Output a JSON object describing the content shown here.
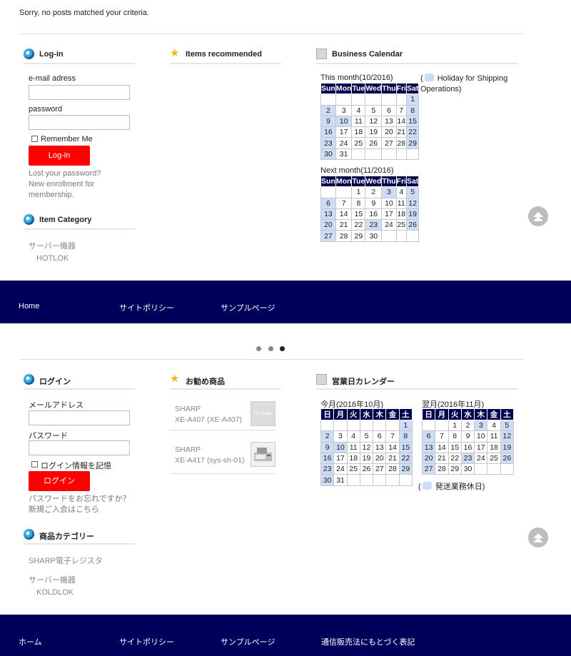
{
  "notice": "Sorry, no posts matched your criteria.",
  "en": {
    "login": {
      "title": "Log-in",
      "email_label": "e-mail adress",
      "email_value": "",
      "password_label": "password",
      "password_value": "",
      "remember": "Remember Me",
      "button": "Log-in",
      "lost": "Lost your password?",
      "new1": "New enrollment for",
      "new2": "membership."
    },
    "category": {
      "title": "Item Category",
      "items": [
        "サーバー機器",
        "HOTLOK"
      ]
    },
    "recommended": {
      "title": "Items recommended"
    },
    "calendar": {
      "title": "Business Calendar",
      "this_month": "This month(10/2016)",
      "next_month": "Next month(11/2016)",
      "legend_open": "(",
      "legend": "Holiday for Shipping",
      "legend2": "Operations)",
      "weekdays": [
        "Sun",
        "Mon",
        "Tue",
        "Wed",
        "Thu",
        "Fri",
        "Sat"
      ]
    },
    "footer": [
      "Home",
      "サイトポリシー",
      "サンプルページ"
    ]
  },
  "jp": {
    "login": {
      "title": "ログイン",
      "email_label": "メールアドレス",
      "email_value": "",
      "password_label": "パスワード",
      "password_value": "",
      "remember": "ログイン情報を記憶",
      "button": "ログイン",
      "lost": "パスワードをお忘れですか？",
      "new": "新規ご入会はこちら"
    },
    "category": {
      "title": "商品カテゴリー",
      "items": [
        "SHARP電子レジスタ",
        "サーバー機器",
        "KOLDLOK"
      ]
    },
    "recommended": {
      "title": "お勧め商品",
      "items": [
        {
          "brand": "SHARP",
          "name": "XE-A407 (XE-A407)",
          "thumb": "No Image"
        },
        {
          "brand": "SHARP",
          "name": "XE-A417 (sys-sh-01)",
          "thumb": ""
        }
      ]
    },
    "calendar": {
      "title": "営業日カレンダー",
      "this_month": "今月(2016年10月)",
      "next_month": "翌月(2016年11月)",
      "legend_open": "(",
      "legend": "発送業務休日)",
      "weekdays": [
        "日",
        "月",
        "火",
        "水",
        "木",
        "金",
        "土"
      ]
    },
    "footer": [
      "ホーム",
      "サイトポリシー",
      "サンプルページ",
      "通信販売法にもとづく表記"
    ]
  },
  "calendars": {
    "oct2016": {
      "weeks": [
        [
          "",
          "",
          "",
          "",
          "",
          "",
          "1"
        ],
        [
          "2",
          "3",
          "4",
          "5",
          "6",
          "7",
          "8"
        ],
        [
          "9",
          "10",
          "11",
          "12",
          "13",
          "14",
          "15"
        ],
        [
          "16",
          "17",
          "18",
          "19",
          "20",
          "21",
          "22"
        ],
        [
          "23",
          "24",
          "25",
          "26",
          "27",
          "28",
          "29"
        ],
        [
          "30",
          "31",
          "",
          "",
          "",
          "",
          ""
        ]
      ],
      "holidays": [
        "1",
        "2",
        "8",
        "9",
        "10",
        "15",
        "16",
        "22",
        "23",
        "29",
        "30"
      ]
    },
    "nov2016": {
      "weeks": [
        [
          "",
          "",
          "1",
          "2",
          "3",
          "4",
          "5"
        ],
        [
          "6",
          "7",
          "8",
          "9",
          "10",
          "11",
          "12"
        ],
        [
          "13",
          "14",
          "15",
          "16",
          "17",
          "18",
          "19"
        ],
        [
          "20",
          "21",
          "22",
          "23",
          "24",
          "25",
          "26"
        ],
        [
          "27",
          "28",
          "29",
          "30",
          "",
          "",
          ""
        ]
      ],
      "holidays": [
        "3",
        "5",
        "6",
        "12",
        "13",
        "19",
        "20",
        "23",
        "26",
        "27"
      ]
    }
  },
  "colors": {
    "footer": "#00005a",
    "button": "#ff0000",
    "holiday": "#cdddf8",
    "cal_header": "#00004d"
  },
  "icons": {
    "login": "globe-icon",
    "category": "globe-icon",
    "recommended": "star-icon",
    "calendar": "calendar-icon",
    "to_top": "double-chevron-up-icon"
  },
  "slider": {
    "dots": 3,
    "active": 3
  }
}
